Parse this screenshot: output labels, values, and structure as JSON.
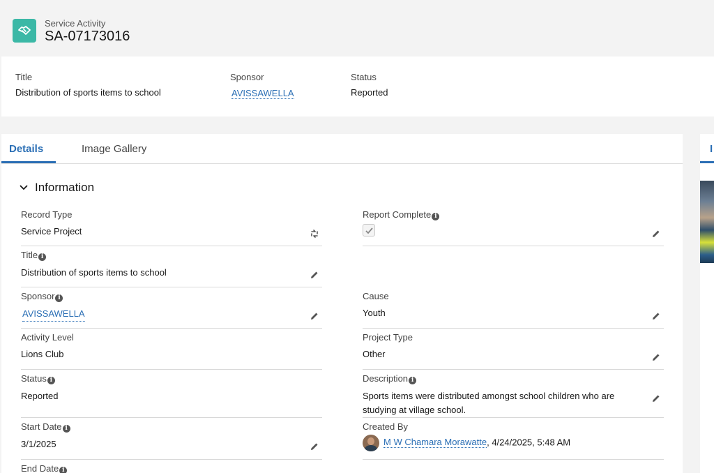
{
  "header": {
    "object_type": "Service Activity",
    "record_name": "SA-07173016",
    "icon": "handshake-icon",
    "icon_color": "#3bb8a6"
  },
  "highlights": {
    "title_label": "Title",
    "title_value": "Distribution of sports items to school",
    "sponsor_label": "Sponsor",
    "sponsor_value": "AVISSAWELLA",
    "status_label": "Status",
    "status_value": "Reported"
  },
  "tabs": {
    "details": "Details",
    "image_gallery": "Image Gallery",
    "side_tab": "I"
  },
  "section": {
    "title": "Information"
  },
  "fields": {
    "record_type": {
      "label": "Record Type",
      "value": "Service Project"
    },
    "report_complete": {
      "label": "Report Complete",
      "checked": true
    },
    "title": {
      "label": "Title",
      "value": "Distribution of sports items to school"
    },
    "sponsor": {
      "label": "Sponsor",
      "value": "AVISSAWELLA"
    },
    "cause": {
      "label": "Cause",
      "value": "Youth"
    },
    "activity_level": {
      "label": "Activity Level",
      "value": "Lions Club"
    },
    "project_type": {
      "label": "Project Type",
      "value": "Other"
    },
    "status": {
      "label": "Status",
      "value": "Reported"
    },
    "description": {
      "label": "Description",
      "value": "Sports items were distributed amongst school children who are studying at village school."
    },
    "start_date": {
      "label": "Start Date",
      "value": "3/1/2025"
    },
    "created_by": {
      "label": "Created By",
      "user": "M W Chamara Morawatte",
      "timestamp": ", 4/24/2025, 5:48 AM"
    },
    "end_date": {
      "label": "End Date"
    }
  },
  "colors": {
    "link": "#2b6fb5",
    "accent": "#2b6fb5"
  }
}
